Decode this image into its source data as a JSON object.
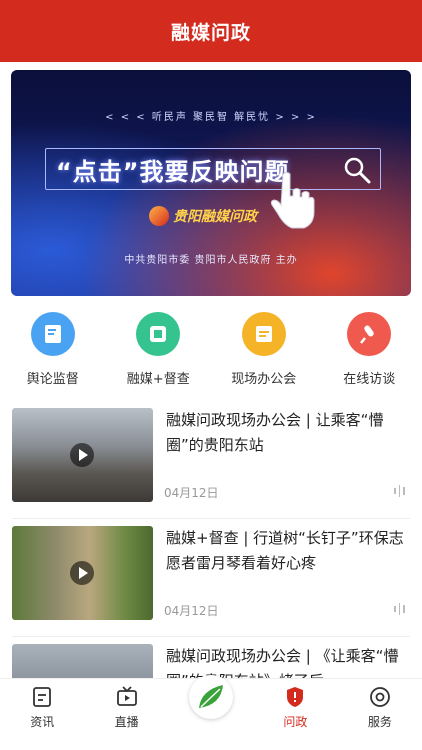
{
  "header": {
    "title": "融媒问政"
  },
  "banner": {
    "tagline": "< < < 听民声    聚民智    解民忧 > > >",
    "headline": "“点击”我要反映问题",
    "logo_text": "贵阳融媒问政",
    "host": "中共贵阳市委  贵阳市人民政府  主办"
  },
  "quick_actions": [
    {
      "label": "舆论监督",
      "icon": "report-icon",
      "color": "#4aa3f2"
    },
    {
      "label": "融媒+督查",
      "icon": "inspect-icon",
      "color": "#35c38f"
    },
    {
      "label": "现场办公会",
      "icon": "meeting-icon",
      "color": "#f5b428"
    },
    {
      "label": "在线访谈",
      "icon": "mic-icon",
      "color": "#f05a4e"
    }
  ],
  "news": [
    {
      "title": "融媒问政现场办公会  |  让乘客“懵圈”的贵阳东站",
      "date": "04月12日"
    },
    {
      "title": "融媒+督查  |  行道树“长钉子”环保志愿者雷月琴看着好心疼",
      "date": "04月12日"
    },
    {
      "title": "融媒问政现场办公会  |  《让乘客“懵圈”的贵阳东站》烤了后",
      "date": ""
    }
  ],
  "tabbar": [
    {
      "label": "资讯",
      "icon": "news-icon",
      "active": false
    },
    {
      "label": "直播",
      "icon": "tv-icon",
      "active": false
    },
    {
      "label": "",
      "icon": "leaf-icon",
      "active": false
    },
    {
      "label": "问政",
      "icon": "shield-icon",
      "active": true
    },
    {
      "label": "服务",
      "icon": "service-icon",
      "active": false
    }
  ],
  "colors": {
    "brand": "#d42b1f"
  }
}
